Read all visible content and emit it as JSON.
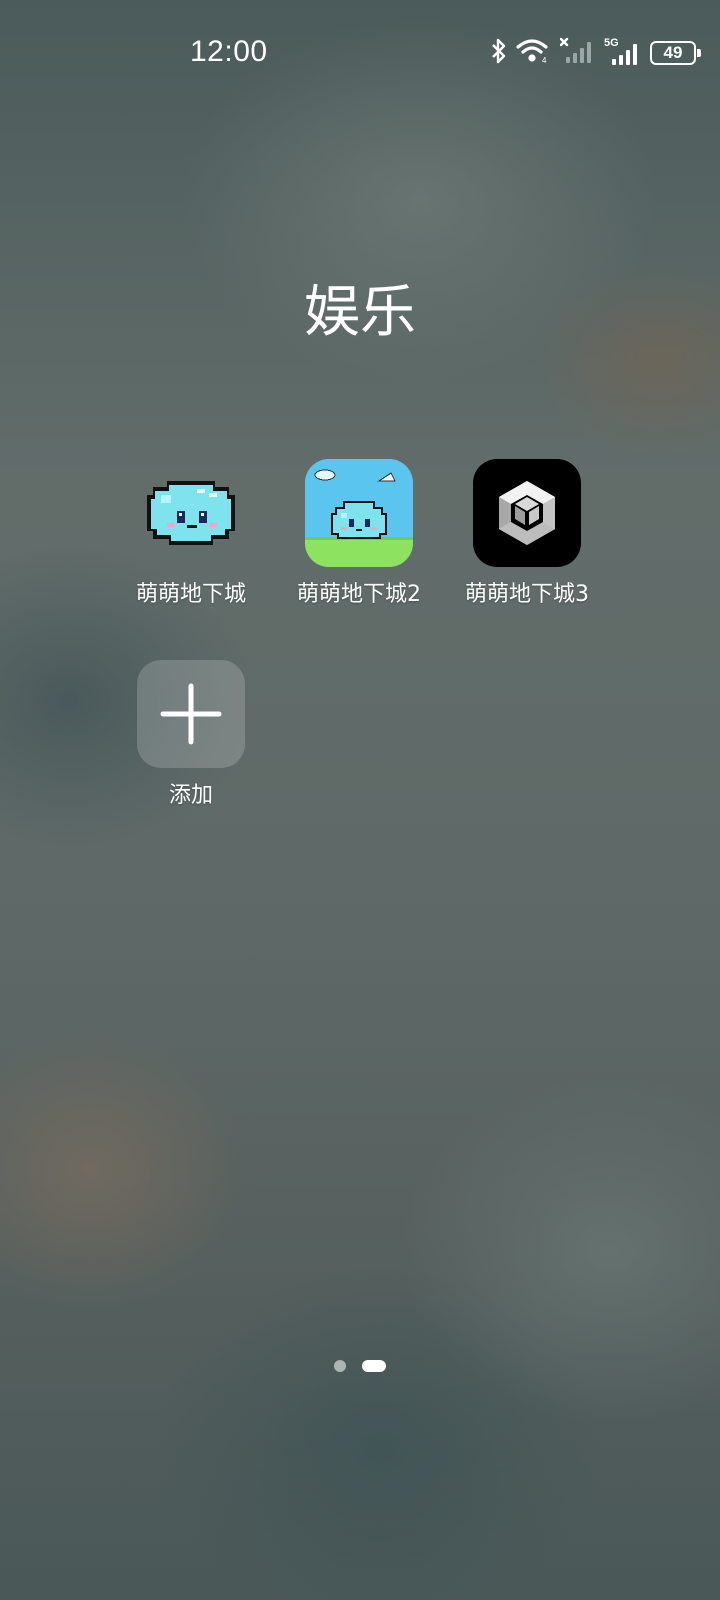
{
  "status_bar": {
    "time": "12:00",
    "icons": [
      "bluetooth-icon",
      "wifi-icon",
      "signal-no-sim-icon",
      "signal-5g-icon"
    ],
    "network_label": "5G",
    "battery_level": "49"
  },
  "folder": {
    "title": "娱乐",
    "apps": [
      {
        "label": "萌萌地下城",
        "icon": "slime-icon"
      },
      {
        "label": "萌萌地下城2",
        "icon": "slime-landscape-icon"
      },
      {
        "label": "萌萌地下城3",
        "icon": "unity-icon"
      }
    ],
    "add_label": "添加"
  },
  "pager": {
    "pages": 2,
    "active_index": 1
  }
}
